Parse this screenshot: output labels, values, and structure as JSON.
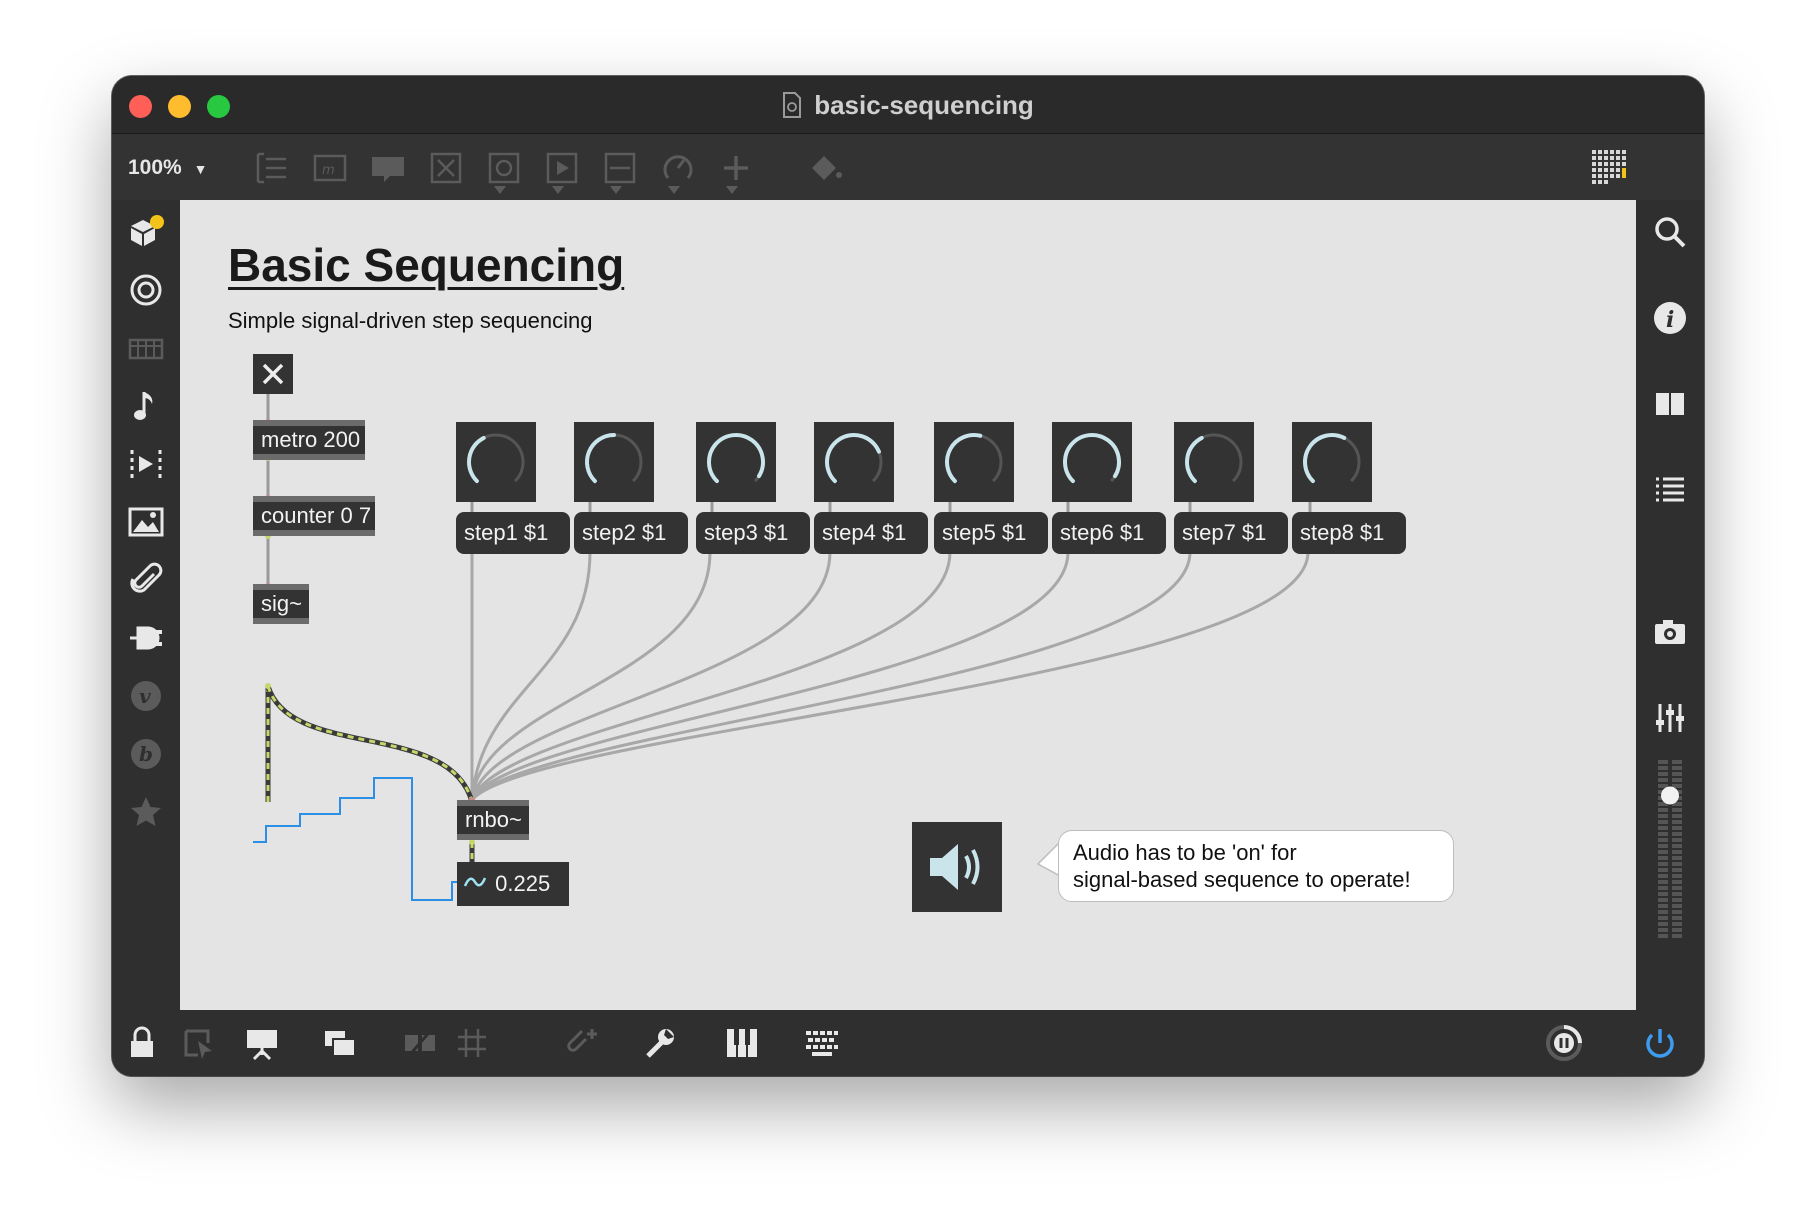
{
  "window": {
    "title": "basic-sequencing",
    "zoom_label": "100%"
  },
  "toolbar": {
    "icons": [
      "newobject-icon",
      "message-icon",
      "comment-icon",
      "toggle-icon",
      "button-icon",
      "play-icon",
      "slider-icon",
      "dial-icon",
      "add-icon",
      "paint-bucket-icon",
      "grid-view-icon"
    ]
  },
  "left_sidebar": {
    "icons": [
      "packages-icon",
      "target-icon",
      "keyboard-icon",
      "music-note-icon",
      "sequence-icon",
      "image-icon",
      "paperclip-icon",
      "plug-icon",
      "v-icon",
      "b-icon",
      "star-icon"
    ],
    "packages_badge_color": "#f2c318"
  },
  "right_sidebar": {
    "icons": [
      "search-icon",
      "info-icon",
      "columns-icon",
      "list-icon",
      "camera-icon",
      "mixer-icon",
      "level-meter-icon"
    ],
    "level_meter_value": 0.79
  },
  "bottom_toolbar": {
    "icons": [
      "lock-icon",
      "presentation-select-icon",
      "presentation-icon",
      "windows-icon",
      "hide-icon",
      "grid-icon",
      "attach-icon",
      "wrench-icon",
      "piano-icon",
      "keyboard-grid-icon",
      "cpu-meter-icon",
      "power-icon"
    ]
  },
  "patch": {
    "title": "Basic Sequencing",
    "subtitle": "Simple signal-driven step sequencing",
    "objects": {
      "metro": "metro 200",
      "counter": "counter 0 7",
      "sig": "sig~",
      "rnbo": "rnbo~"
    },
    "toggle_state": "on",
    "steps": [
      {
        "label": "step1 $1",
        "value": 0.4
      },
      {
        "label": "step2 $1",
        "value": 0.5
      },
      {
        "label": "step3 $1",
        "value": 0.95
      },
      {
        "label": "step4 $1",
        "value": 0.75
      },
      {
        "label": "step5 $1",
        "value": 0.55
      },
      {
        "label": "step6 $1",
        "value": 0.95
      },
      {
        "label": "step7 $1",
        "value": 0.4
      },
      {
        "label": "step8 $1",
        "value": 0.6
      }
    ],
    "number_display": "0.225",
    "speaker_state": "on",
    "comment": {
      "line1": "Audio has to be 'on' for",
      "line2": "signal-based sequence to operate!"
    },
    "colors": {
      "object_bg": "#333333",
      "dial_arc": "#c9e4ea",
      "scope_line": "#2b8fe8",
      "signal_cord": "#c7d66b",
      "cursor_dot": "#2b9cf0"
    }
  }
}
